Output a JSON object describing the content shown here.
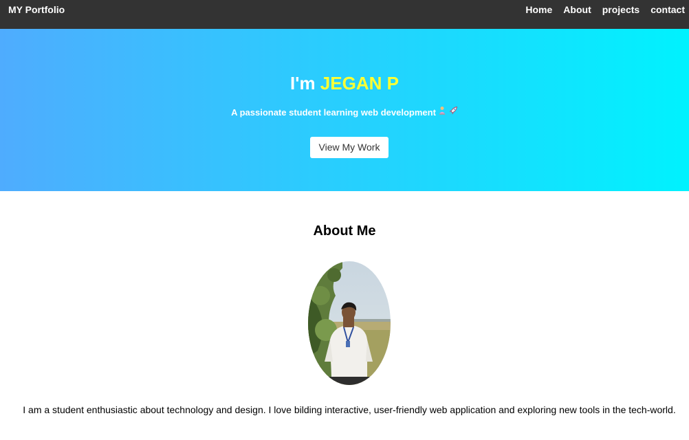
{
  "nav": {
    "brand": "MY Portfolio",
    "links": [
      "Home",
      "About",
      "projects",
      "contact"
    ]
  },
  "hero": {
    "greeting": "I'm ",
    "name": "JEGAN P",
    "tagline": "A passionate student learning web development",
    "tagline_icons": [
      "person-at-laptop-icon",
      "rocket-icon"
    ],
    "button_label": "View My Work",
    "gradient": [
      "#4facfe",
      "#00f2fe"
    ],
    "name_color": "#ffff33"
  },
  "about": {
    "title": "About Me",
    "text": "I am a student enthusiastic about technology and design. I love bilding interactive, user-friendly web application and exploring new tools in the tech-world."
  },
  "colors": {
    "navbar": "#333333",
    "nav_text": "#ffffff"
  }
}
